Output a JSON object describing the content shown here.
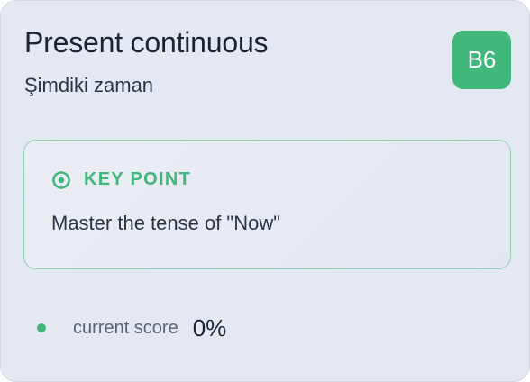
{
  "lesson": {
    "title": "Present continuous",
    "subtitle": "Şimdiki zaman",
    "level_badge": "B6"
  },
  "key_point": {
    "icon": "target-icon",
    "label": "KEY POINT",
    "text": "Master the tense of \"Now\""
  },
  "score": {
    "label": "current score",
    "value": "0%"
  },
  "colors": {
    "accent": "#41b77c",
    "card_background": "#e4e8f1",
    "text_primary": "#1c2433"
  }
}
